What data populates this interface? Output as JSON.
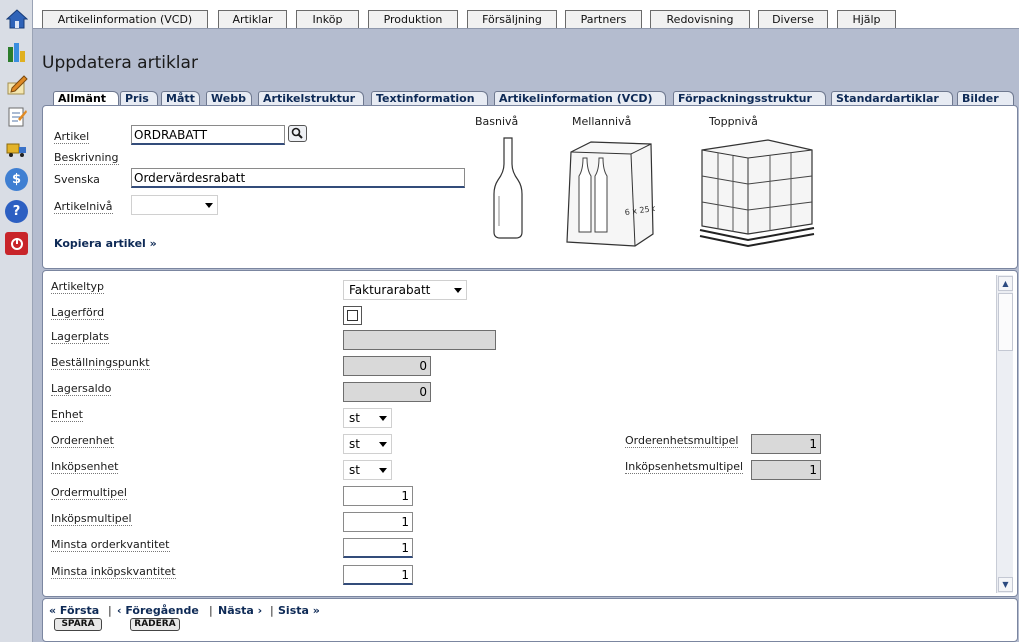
{
  "topmenu": [
    "Artikelinformation (VCD)",
    "Artiklar",
    "Inköp",
    "Produktion",
    "Försäljning",
    "Partners",
    "Redovisning",
    "Diverse",
    "Hjälp"
  ],
  "sidebar_icons": [
    "home-icon",
    "chart-icon",
    "pen-icon",
    "notepad-icon",
    "truck-icon",
    "dollar-icon",
    "help-icon",
    "power-icon"
  ],
  "page_title": "Uppdatera artiklar",
  "subtabs": [
    "Allmänt",
    "Pris",
    "Mått",
    "Webb",
    "Artikelstruktur",
    "Textinformation",
    "Artikelinformation (VCD)",
    "Förpackningsstruktur",
    "Standardartiklar",
    "Bilder"
  ],
  "general": {
    "artikel_label": "Artikel",
    "artikel_value": "ORDRABATT",
    "beskrivning_label": "Beskrivning",
    "svenska_label": "Svenska",
    "svenska_value": "Ordervärdesrabatt",
    "artikelniva_label": "Artikelnivå",
    "artikelniva_value": "",
    "copy_link": "Kopiera artikel »"
  },
  "levels": [
    "Basnivå",
    "Mellannivå",
    "Toppnivå"
  ],
  "middle_box_text": "6 x 25 cl",
  "details": {
    "artikeltyp": {
      "label": "Artikeltyp",
      "value": "Fakturarabatt"
    },
    "lagerford": {
      "label": "Lagerförd"
    },
    "lagerplats": {
      "label": "Lagerplats",
      "value": ""
    },
    "bestallningspunkt": {
      "label": "Beställningspunkt",
      "value": "0"
    },
    "lagersaldo": {
      "label": "Lagersaldo",
      "value": "0"
    },
    "enhet": {
      "label": "Enhet",
      "value": "st"
    },
    "orderenhet": {
      "label": "Orderenhet",
      "value": "st"
    },
    "inkopsenhet": {
      "label": "Inköpsenhet",
      "value": "st"
    },
    "ordermultipel": {
      "label": "Ordermultipel",
      "value": "1"
    },
    "inkopsmultipel": {
      "label": "Inköpsmultipel",
      "value": "1"
    },
    "minsta_orderkvantitet": {
      "label": "Minsta orderkvantitet",
      "value": "1"
    },
    "minsta_inkopskvantitet": {
      "label": "Minsta inköpskvantitet",
      "value": "1"
    },
    "orderenhetsmultipel": {
      "label": "Orderenhetsmultipel",
      "value": "1"
    },
    "inkopsenhetsmultipel": {
      "label": "Inköpsenhetsmultipel",
      "value": "1"
    }
  },
  "nav": {
    "first": "« Första",
    "sep": "|",
    "prev": "‹ Föregående",
    "next": "Nästa ›",
    "last": "Sista »"
  },
  "buttons": {
    "save": "SPARA",
    "delete": "RADERA"
  }
}
